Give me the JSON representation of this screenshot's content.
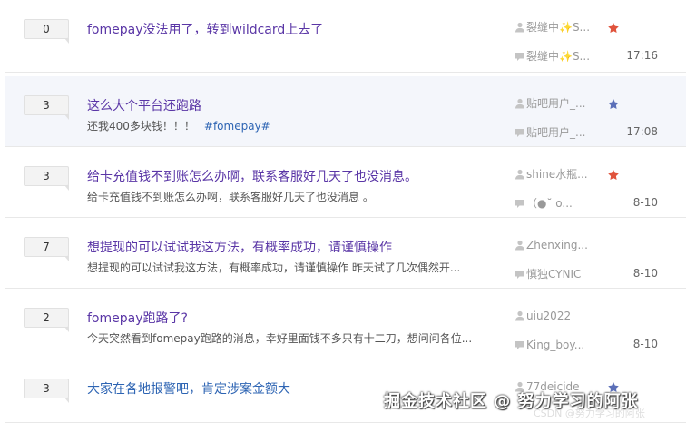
{
  "threads": [
    {
      "replies": "0",
      "title": "fomepay没法用了，转到wildcard上去了",
      "abstract": "",
      "tag": "",
      "author": "裂缝中✨S...",
      "last_reply_user": "裂缝中✨S...",
      "time": "17:16",
      "level_badge_color": "#e0533c",
      "highlighted": false
    },
    {
      "replies": "3",
      "title": "这么大个平台还跑路",
      "abstract": "还我400多块钱！！！",
      "tag": "#fomepay#",
      "author": "贴吧用户_...",
      "last_reply_user": "贴吧用户_...",
      "time": "17:08",
      "level_badge_color": "#5b6fb8",
      "highlighted": true
    },
    {
      "replies": "3",
      "title": "给卡充值钱不到账怎么办啊，联系客服好几天了也没消息。",
      "abstract": "给卡充值钱不到账怎么办啊，联系客服好几天了也没消息 。",
      "tag": "",
      "author": "shine水瓶...",
      "last_reply_user": "（●˘ o...",
      "time": "8-10",
      "level_badge_color": "#e0533c",
      "highlighted": false
    },
    {
      "replies": "7",
      "title": "想提现的可以试试我这方法，有概率成功，请谨慎操作",
      "abstract": "想提现的可以试试我这方法，有概率成功，请谨慎操作 昨天试了几次偶然开...",
      "tag": "",
      "author": "Zhenxing...",
      "last_reply_user": "慎独CYNIC",
      "time": "8-10",
      "level_badge_color": "",
      "highlighted": false
    },
    {
      "replies": "2",
      "title": "fomepay跑路了?",
      "abstract": "今天突然看到fomepay跑路的消息，幸好里面钱不多只有十二刀，想问问各位...",
      "tag": "",
      "author": "uiu2022",
      "last_reply_user": "King_boy...",
      "time": "8-10",
      "level_badge_color": "",
      "highlighted": false
    },
    {
      "replies": "3",
      "title": "大家在各地报警吧，肯定涉案金额大",
      "abstract": "",
      "tag": "",
      "author": "77deicide",
      "last_reply_user": "",
      "time": "",
      "level_badge_color": "#5b6fb8",
      "highlighted": false
    }
  ],
  "icons": {
    "author": "user-icon",
    "last_reply": "comment-icon",
    "level": "level-badge-icon"
  },
  "watermark": "掘金技术社区 @ 努力学习的阿张",
  "watermark_sub": "CSDN @努力学习的阿张",
  "colors": {
    "title_visited": "#5a36a6",
    "title_link": "#2d64b3",
    "highlight_bg": "#f4f6fb"
  }
}
